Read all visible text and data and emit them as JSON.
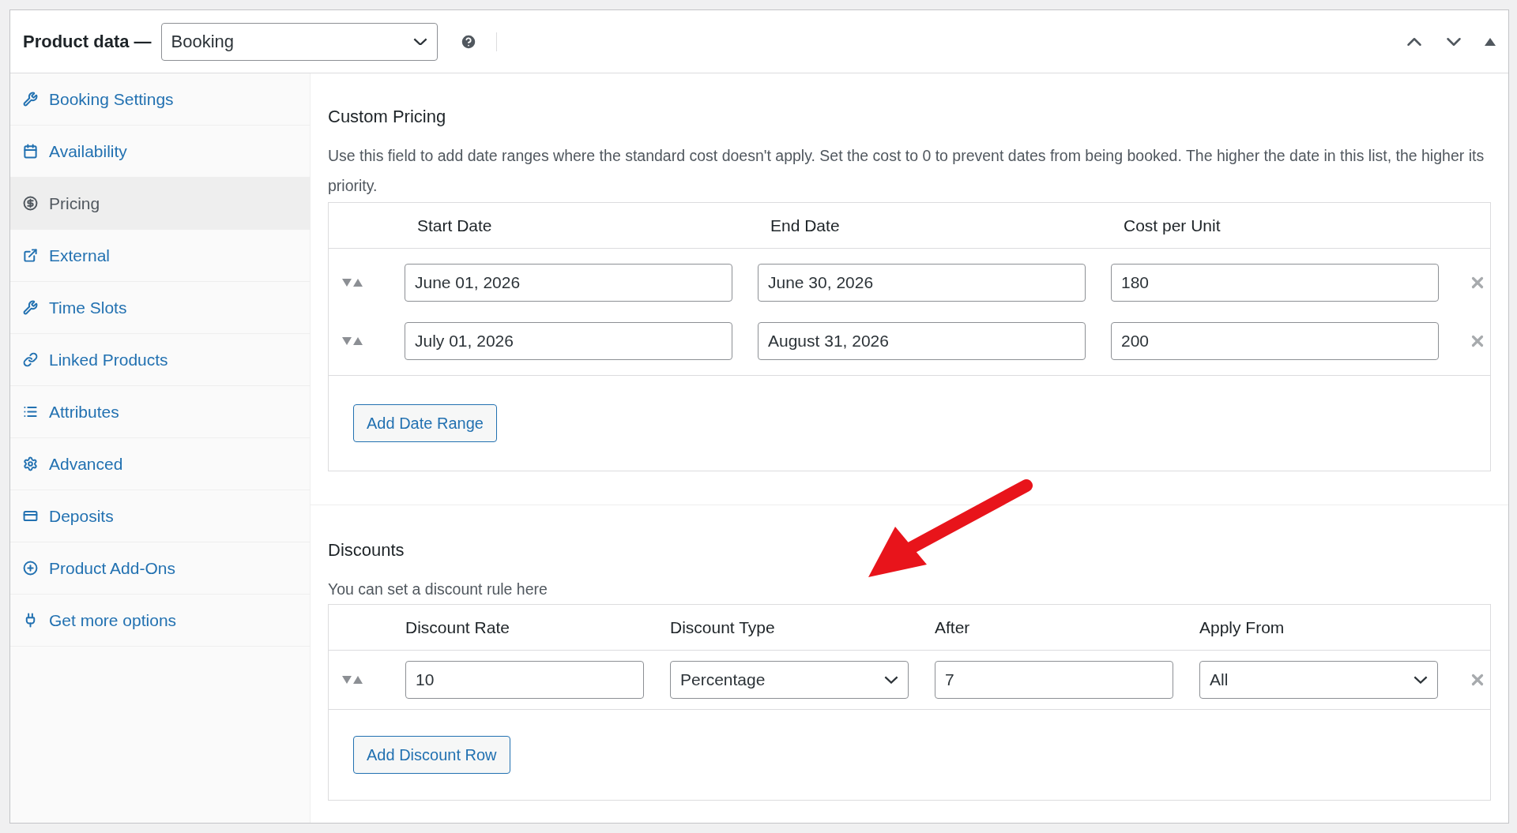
{
  "header": {
    "title": "Product data —",
    "product_type": "Booking"
  },
  "sidebar": {
    "items": [
      {
        "label": "Booking Settings",
        "selected": false
      },
      {
        "label": "Availability",
        "selected": false
      },
      {
        "label": "Pricing",
        "selected": true
      },
      {
        "label": "External",
        "selected": false
      },
      {
        "label": "Time Slots",
        "selected": false
      },
      {
        "label": "Linked Products",
        "selected": false
      },
      {
        "label": "Attributes",
        "selected": false
      },
      {
        "label": "Advanced",
        "selected": false
      },
      {
        "label": "Deposits",
        "selected": false
      },
      {
        "label": "Product Add-Ons",
        "selected": false
      },
      {
        "label": "Get more options",
        "selected": false
      }
    ]
  },
  "custom_pricing": {
    "title": "Custom Pricing",
    "description": "Use this field to add date ranges where the standard cost doesn't apply. Set the cost to 0 to prevent dates from being booked. The higher the date in this list, the higher its priority.",
    "columns": [
      "Start Date",
      "End Date",
      "Cost per Unit"
    ],
    "rows": [
      {
        "start": "June 01, 2026",
        "end": "June 30, 2026",
        "cost": "180"
      },
      {
        "start": "July 01, 2026",
        "end": "August 31, 2026",
        "cost": "200"
      }
    ],
    "button": "Add Date Range"
  },
  "discounts": {
    "title": "Discounts",
    "description": "You can set a discount rule here",
    "columns": [
      "Discount Rate",
      "Discount Type",
      "After",
      "Apply From"
    ],
    "rows": [
      {
        "rate": "10",
        "type": "Percentage",
        "after": "7",
        "apply_from": "All"
      }
    ],
    "button": "Add Discount Row"
  }
}
